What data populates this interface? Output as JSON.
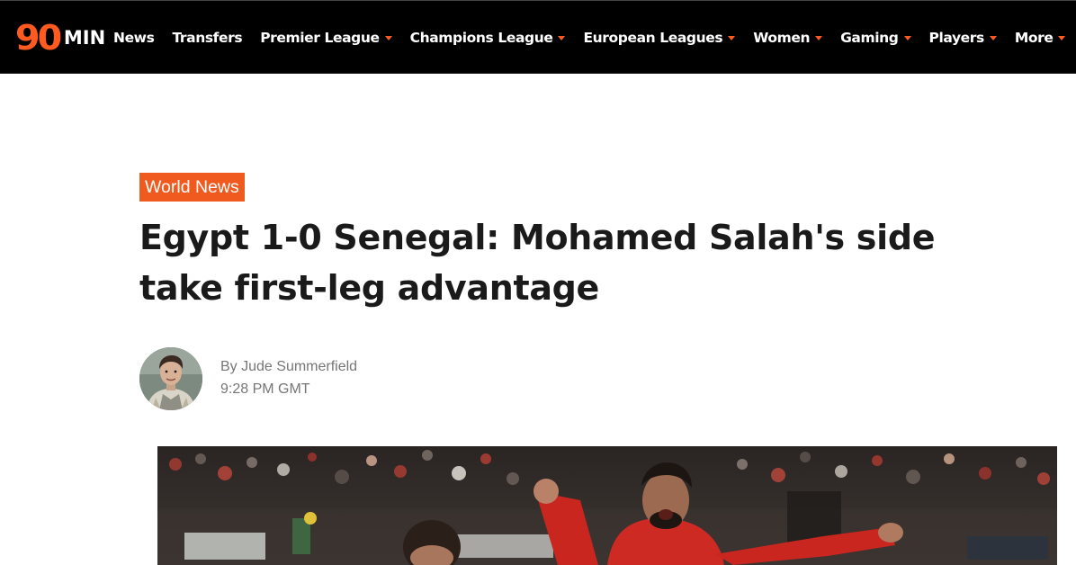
{
  "site": {
    "logo_numeral": "90",
    "logo_word": "MIN",
    "accent_color": "#f15a1f"
  },
  "nav": {
    "items": [
      {
        "label": "News",
        "has_dropdown": false
      },
      {
        "label": "Transfers",
        "has_dropdown": false
      },
      {
        "label": "Premier League",
        "has_dropdown": true
      },
      {
        "label": "Champions League",
        "has_dropdown": true
      },
      {
        "label": "European Leagues",
        "has_dropdown": true
      },
      {
        "label": "Women",
        "has_dropdown": true
      },
      {
        "label": "Gaming",
        "has_dropdown": true
      },
      {
        "label": "Players",
        "has_dropdown": true
      },
      {
        "label": "More",
        "has_dropdown": true
      }
    ]
  },
  "article": {
    "category": "World News",
    "headline": "Egypt 1-0 Senegal: Mohamed Salah's side take first-leg advantage",
    "byline_prefix": "By",
    "author": "Jude Summerfield",
    "time": "9:28 PM GMT"
  }
}
